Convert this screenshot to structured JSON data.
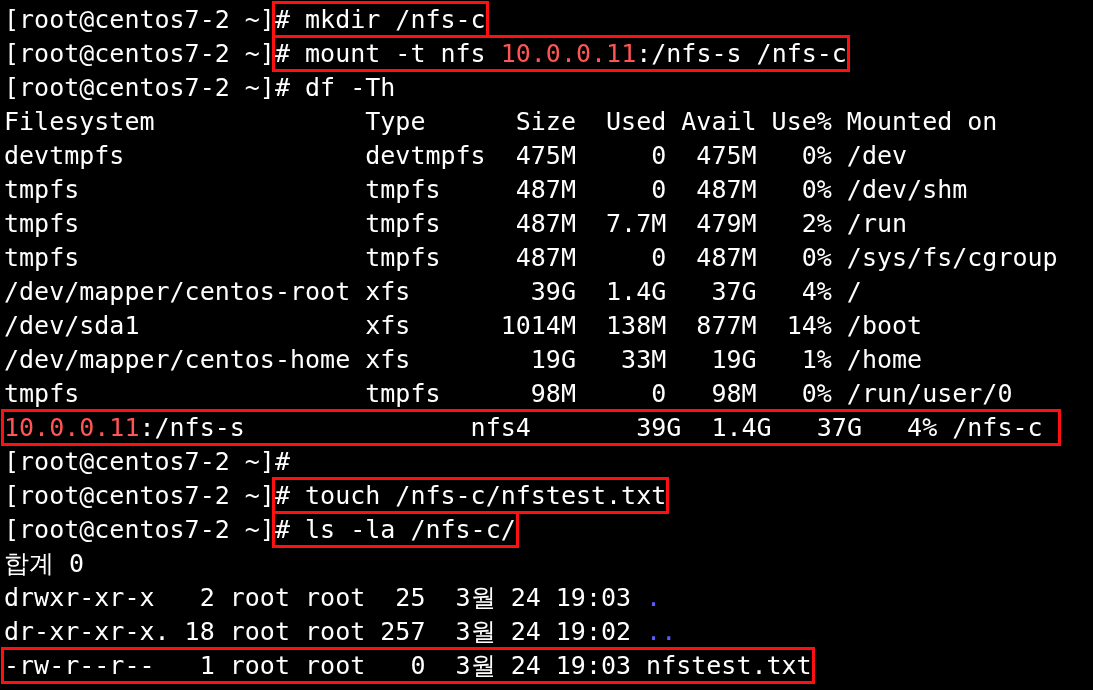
{
  "terminal": {
    "lines": [
      {
        "parts": [
          {
            "kind": "plain",
            "segments": [
              {
                "text": "[root@centos7-2 ~]",
                "kind": "normal"
              }
            ]
          },
          {
            "kind": "boxed",
            "segments": [
              {
                "text": "# mkdir /nfs-c",
                "kind": "normal"
              }
            ]
          }
        ]
      },
      {
        "parts": [
          {
            "kind": "plain",
            "segments": [
              {
                "text": "[root@centos7-2 ~]",
                "kind": "normal"
              }
            ]
          },
          {
            "kind": "boxed",
            "segments": [
              {
                "text": "# mount -t nfs ",
                "kind": "normal"
              },
              {
                "text": "10.0.0.11",
                "kind": "address"
              },
              {
                "text": ":/nfs-s /nfs-c",
                "kind": "normal"
              }
            ]
          }
        ]
      },
      {
        "parts": [
          {
            "kind": "plain",
            "segments": [
              {
                "text": "[root@centos7-2 ~]# df -Th",
                "kind": "normal"
              }
            ]
          }
        ]
      },
      {
        "parts": [
          {
            "kind": "plain",
            "segments": [
              {
                "text": "Filesystem              Type      Size  Used Avail Use% Mounted on",
                "kind": "normal"
              }
            ]
          }
        ]
      },
      {
        "parts": [
          {
            "kind": "plain",
            "segments": [
              {
                "text": "devtmpfs                devtmpfs  475M     0  475M   0% /dev",
                "kind": "normal"
              }
            ]
          }
        ]
      },
      {
        "parts": [
          {
            "kind": "plain",
            "segments": [
              {
                "text": "tmpfs                   tmpfs     487M     0  487M   0% /dev/shm",
                "kind": "normal"
              }
            ]
          }
        ]
      },
      {
        "parts": [
          {
            "kind": "plain",
            "segments": [
              {
                "text": "tmpfs                   tmpfs     487M  7.7M  479M   2% /run",
                "kind": "normal"
              }
            ]
          }
        ]
      },
      {
        "parts": [
          {
            "kind": "plain",
            "segments": [
              {
                "text": "tmpfs                   tmpfs     487M     0  487M   0% /sys/fs/cgroup",
                "kind": "normal"
              }
            ]
          }
        ]
      },
      {
        "parts": [
          {
            "kind": "plain",
            "segments": [
              {
                "text": "/dev/mapper/centos-root xfs        39G  1.4G   37G   4% /",
                "kind": "normal"
              }
            ]
          }
        ]
      },
      {
        "parts": [
          {
            "kind": "plain",
            "segments": [
              {
                "text": "/dev/sda1               xfs      1014M  138M  877M  14% /boot",
                "kind": "normal"
              }
            ]
          }
        ]
      },
      {
        "parts": [
          {
            "kind": "plain",
            "segments": [
              {
                "text": "/dev/mapper/centos-home xfs        19G   33M   19G   1% /home",
                "kind": "normal"
              }
            ]
          }
        ]
      },
      {
        "parts": [
          {
            "kind": "plain",
            "segments": [
              {
                "text": "tmpfs                   tmpfs      98M     0   98M   0% /run/user/0",
                "kind": "normal"
              }
            ]
          }
        ]
      },
      {
        "parts": [
          {
            "kind": "boxed",
            "segments": [
              {
                "text": "10.0.0.11",
                "kind": "address"
              },
              {
                "text": ":/nfs-s               nfs4       39G  1.4G   37G   4% /nfs-c ",
                "kind": "normal"
              }
            ]
          }
        ]
      },
      {
        "parts": [
          {
            "kind": "plain",
            "segments": [
              {
                "text": "[root@centos7-2 ~]#",
                "kind": "normal"
              }
            ]
          }
        ]
      },
      {
        "parts": [
          {
            "kind": "plain",
            "segments": [
              {
                "text": "[root@centos7-2 ~]",
                "kind": "normal"
              }
            ]
          },
          {
            "kind": "boxed",
            "segments": [
              {
                "text": "# touch /nfs-c/nfstest.txt",
                "kind": "normal"
              }
            ]
          }
        ]
      },
      {
        "parts": [
          {
            "kind": "plain",
            "segments": [
              {
                "text": "[root@centos7-2 ~]",
                "kind": "normal"
              }
            ]
          },
          {
            "kind": "boxed",
            "segments": [
              {
                "text": "# ls -la /nfs-c/",
                "kind": "normal"
              }
            ]
          }
        ]
      },
      {
        "parts": [
          {
            "kind": "plain",
            "segments": [
              {
                "text": "합계 0",
                "kind": "normal"
              }
            ]
          }
        ]
      },
      {
        "parts": [
          {
            "kind": "plain",
            "segments": [
              {
                "text": "drwxr-xr-x   2 root root  25  3월 24 19:03 ",
                "kind": "normal"
              },
              {
                "text": ".",
                "kind": "directory"
              }
            ]
          }
        ]
      },
      {
        "parts": [
          {
            "kind": "plain",
            "segments": [
              {
                "text": "dr-xr-xr-x. 18 root root 257  3월 24 19:02 ",
                "kind": "normal"
              },
              {
                "text": "..",
                "kind": "directory"
              }
            ]
          }
        ]
      },
      {
        "parts": [
          {
            "kind": "boxed",
            "segments": [
              {
                "text": "-rw-r--r--   1 root root   0  3월 24 19:03 nfstest.txt",
                "kind": "normal"
              }
            ]
          }
        ]
      }
    ]
  }
}
